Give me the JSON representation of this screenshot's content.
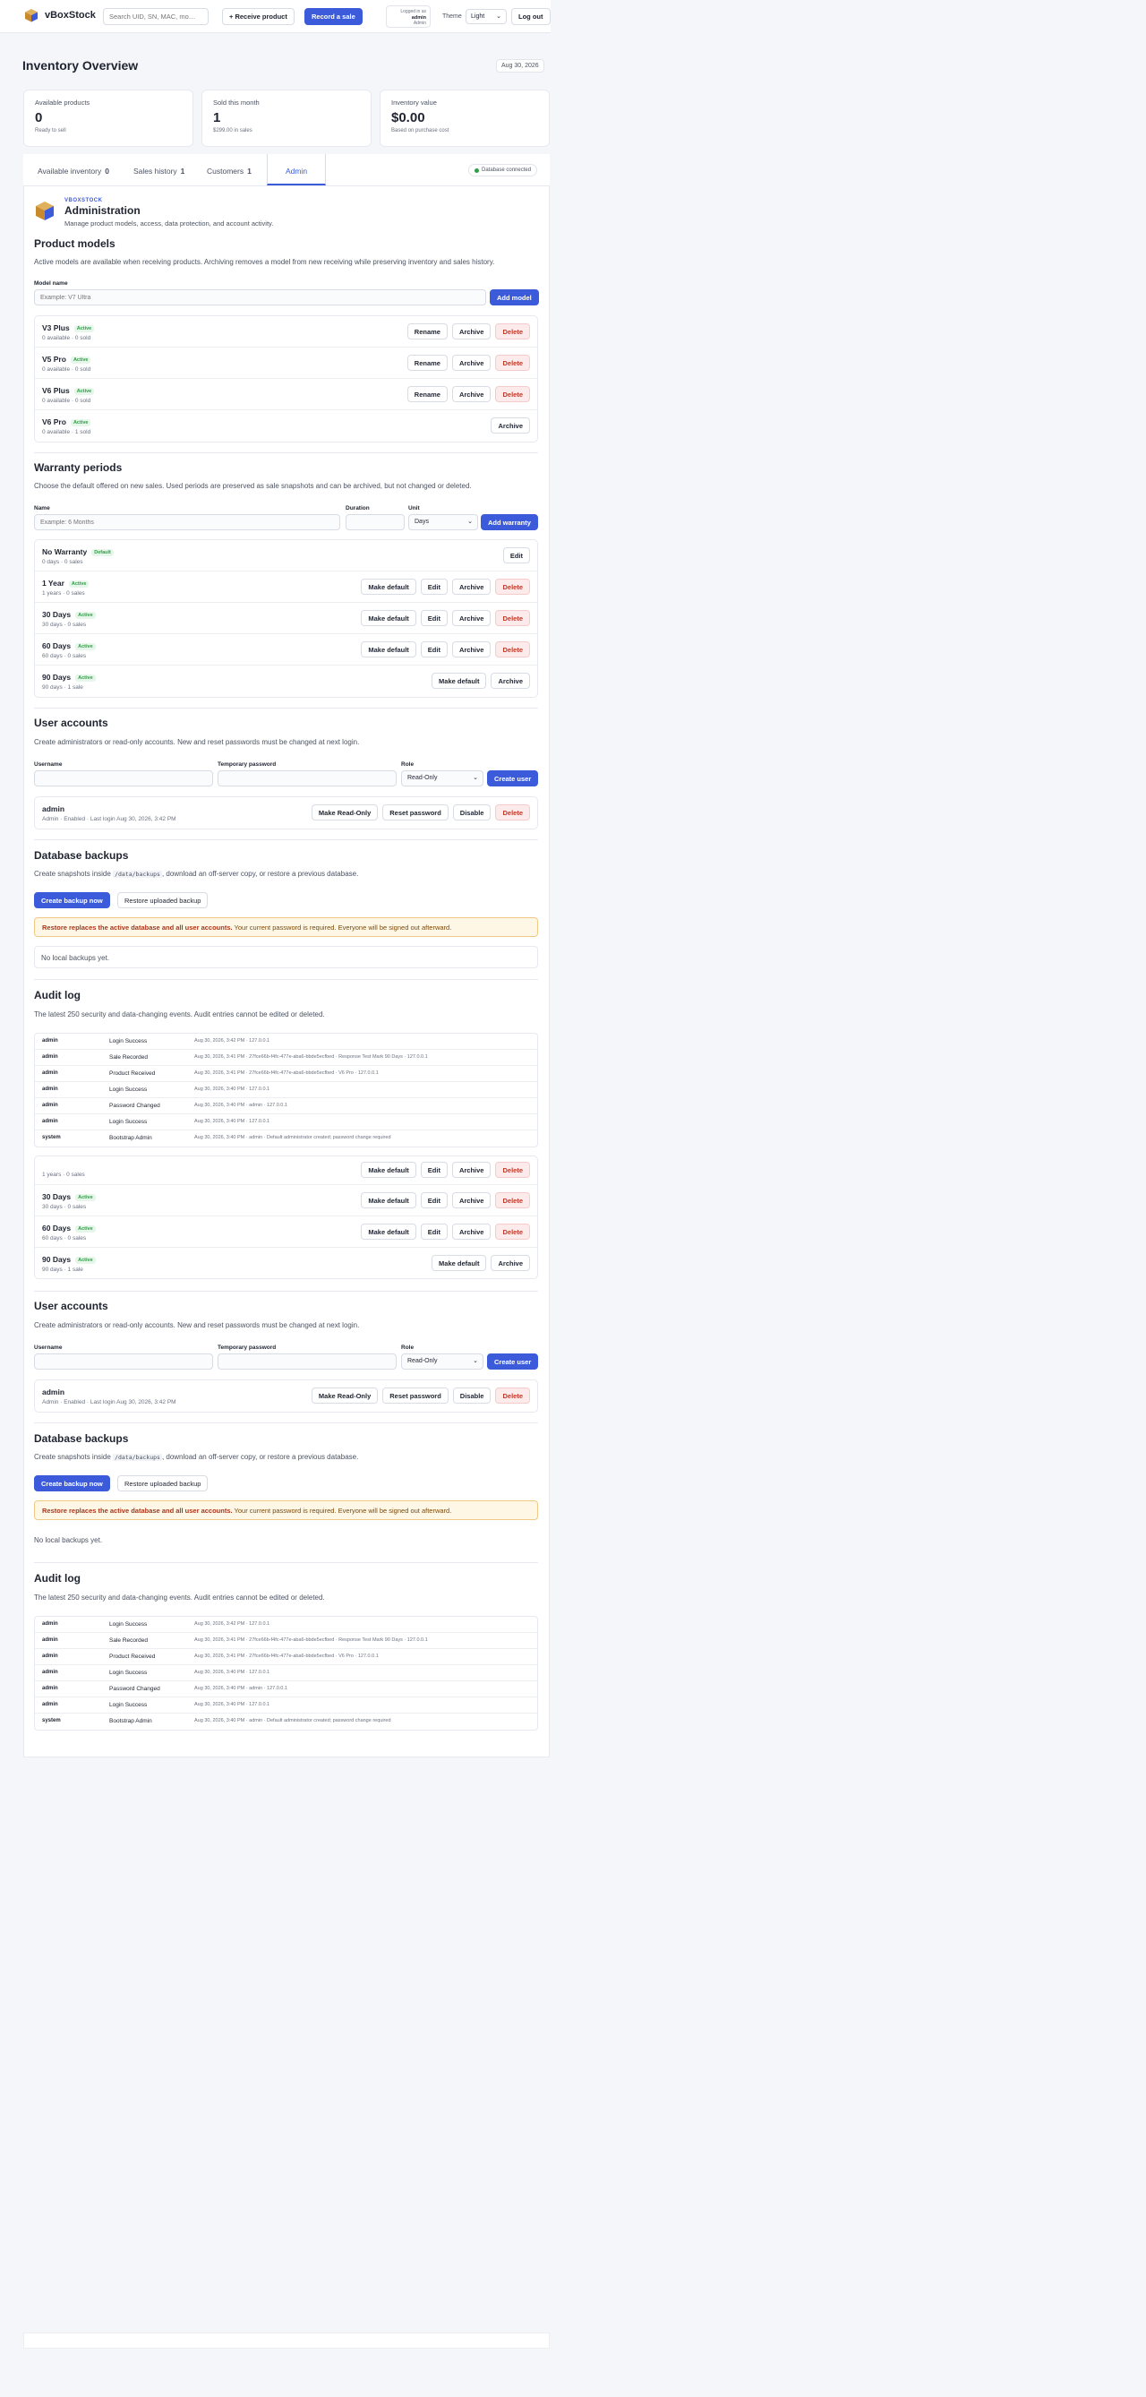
{
  "topbar": {
    "brand": "vBoxStock",
    "search_placeholder": "Search UID, SN, MAC, mo…",
    "receive_label": "+ Receive product",
    "record_label": "Record a sale",
    "user_logged_as": "Logged in as",
    "user_name": "admin",
    "user_role": "Admin",
    "theme_label": "Theme",
    "theme_value": "Light",
    "logout_label": "Log out"
  },
  "page": {
    "title": "Inventory Overview",
    "date": "Aug 30, 2026"
  },
  "stats": [
    {
      "label": "Available products",
      "value": "0",
      "sub": "Ready to sell"
    },
    {
      "label": "Sold this month",
      "value": "1",
      "sub": "$299.00 in sales"
    },
    {
      "label": "Inventory value",
      "value": "$0.00",
      "sub": "Based on purchase cost"
    }
  ],
  "tabs": [
    {
      "label": "Available inventory",
      "count": "0"
    },
    {
      "label": "Sales history",
      "count": "1"
    },
    {
      "label": "Customers",
      "count": "1"
    },
    {
      "label": "Admin",
      "count": ""
    }
  ],
  "db_status": "Database connected",
  "admin": {
    "eyebrow": "VBOXSTOCK",
    "title": "Administration",
    "desc": "Manage product models, access, data protection, and account activity."
  },
  "models": {
    "title": "Product models",
    "desc": "Active models are available when receiving products. Archiving removes a model from new receiving while preserving inventory and sales history.",
    "field_label": "Model name",
    "field_placeholder": "Example: V7 Ultra",
    "add_label": "Add model",
    "rows": [
      {
        "name": "V3 Plus",
        "badge": "Active",
        "meta": "0 available · 0 sold"
      },
      {
        "name": "V5 Pro",
        "badge": "Active",
        "meta": "0 available · 0 sold"
      },
      {
        "name": "V6 Plus",
        "badge": "Active",
        "meta": "0 available · 0 sold"
      },
      {
        "name": "V6 Pro",
        "badge": "Active",
        "meta": "0 available · 1 sold"
      }
    ]
  },
  "warranty": {
    "title": "Warranty periods",
    "desc": "Choose the default offered on new sales. Used periods are preserved as sale snapshots and can be archived, but not changed or deleted.",
    "name_label": "Name",
    "name_placeholder": "Example: 6 Months",
    "duration_label": "Duration",
    "unit_label": "Unit",
    "unit_value": "Days",
    "add_label": "Add warranty",
    "rows": [
      {
        "name": "No Warranty",
        "badge": "Default",
        "meta": "0 days · 0 sales"
      },
      {
        "name": "1 Year",
        "badge": "Active",
        "meta": "1 years · 0 sales"
      },
      {
        "name": "30 Days",
        "badge": "Active",
        "meta": "30 days · 0 sales"
      },
      {
        "name": "60 Days",
        "badge": "Active",
        "meta": "60 days · 0 sales"
      },
      {
        "name": "90 Days",
        "badge": "Active",
        "meta": "90 days · 1 sale"
      }
    ]
  },
  "users": {
    "title": "User accounts",
    "desc": "Create administrators or read-only accounts. New and reset passwords must be changed at next login.",
    "username_label": "Username",
    "password_label": "Temporary password",
    "role_label": "Role",
    "role_value": "Read-Only",
    "create_label": "Create user",
    "row": {
      "name": "admin",
      "meta": "Admin · Enabled · Last login Aug 30, 2026, 3:42 PM"
    }
  },
  "backups": {
    "title": "Database backups",
    "desc_pre": "Create snapshots inside",
    "desc_code": "/data/backups",
    "desc_post": ", download an off-server copy, or restore a previous database.",
    "create_label": "Create backup now",
    "restore_label": "Restore uploaded backup",
    "alert_bold": "Restore replaces the active database and all user accounts.",
    "alert_rest": " Your current password is required. Everyone will be signed out afterward.",
    "empty": "No local backups yet."
  },
  "audit": {
    "title": "Audit log",
    "desc": "The latest 250 security and data-changing events. Audit entries cannot be edited or deleted.",
    "rows": [
      {
        "user": "admin",
        "event": "Login Success",
        "detail": "Aug 30, 2026, 3:42 PM · 127.0.0.1"
      },
      {
        "user": "admin",
        "event": "Sale Recorded",
        "detail": "Aug 30, 2026, 3:41 PM · 27fce66b-f4fc-477e-aba6-bbde5ecfbed · Response Test Mark 90 Days · 127.0.0.1"
      },
      {
        "user": "admin",
        "event": "Product Received",
        "detail": "Aug 30, 2026, 3:41 PM · 27fce66b-f4fc-477e-aba6-bbde5ecfbed · V6 Pro · 127.0.0.1"
      },
      {
        "user": "admin",
        "event": "Login Success",
        "detail": "Aug 30, 2026, 3:40 PM · 127.0.0.1"
      },
      {
        "user": "admin",
        "event": "Password Changed",
        "detail": "Aug 30, 2026, 3:40 PM · admin · 127.0.0.1"
      },
      {
        "user": "admin",
        "event": "Login Success",
        "detail": "Aug 30, 2026, 3:40 PM · 127.0.0.1"
      },
      {
        "user": "system",
        "event": "Bootstrap Admin",
        "detail": "Aug 30, 2026, 3:40 PM · admin · Default administrator created; password change required"
      }
    ]
  },
  "labels": {
    "rename": "Rename",
    "archive": "Archive",
    "delete": "Delete",
    "edit": "Edit",
    "make_default": "Make default",
    "make_readonly": "Make Read-Only",
    "reset_password": "Reset password",
    "disable": "Disable"
  },
  "colors": {
    "accent": "#3b5bdb",
    "danger": "#c0392b",
    "success": "#2f9e44",
    "warning_bg": "#fff7e6"
  }
}
